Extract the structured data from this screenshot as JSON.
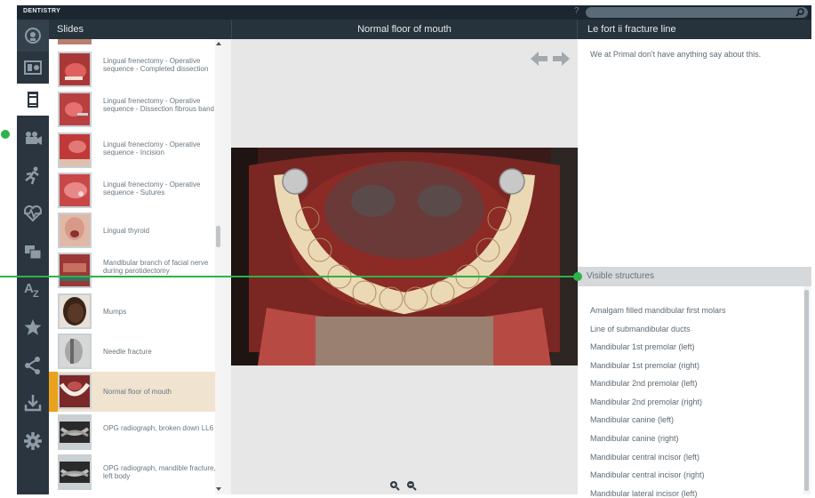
{
  "app": {
    "brand": "DENTISTRY"
  },
  "topbar": {
    "help_label": "?",
    "search_placeholder": ""
  },
  "toolbar": {
    "icons": [
      "3d-anatomy-icon",
      "slides-icon",
      "atlas-icon",
      "video-icon",
      "animation-icon",
      "physiology-icon",
      "folders-icon",
      "a-z-icon",
      "favorites-icon",
      "share-icon",
      "download-icon",
      "settings-icon"
    ]
  },
  "headers": {
    "slides": "Slides",
    "viewer": "Normal floor of mouth",
    "info": "Le fort ii fracture line"
  },
  "slides": [
    {
      "label": "Lingual frenectomy - Operative sequence - Completed dissection",
      "selected": false
    },
    {
      "label": "Lingual frenectomy - Operative sequence - Dissection fibrous band",
      "selected": false
    },
    {
      "label": "Lingual frenectomy - Operative sequence - Incision",
      "selected": false
    },
    {
      "label": "Lingual frenectomy - Operative sequence - Sutures",
      "selected": false
    },
    {
      "label": "Lingual thyroid",
      "selected": false
    },
    {
      "label": "Mandibular branch of facial nerve during parotidectomy",
      "selected": false
    },
    {
      "label": "Mumps",
      "selected": false
    },
    {
      "label": "Needle fracture",
      "selected": false
    },
    {
      "label": "Normal floor of mouth",
      "selected": true
    },
    {
      "label": "OPG radiograph, broken down LL6",
      "selected": false
    },
    {
      "label": "OPG radiograph, mandible fracture, left body",
      "selected": false
    }
  ],
  "info": {
    "note": "We at Primal don't have anything say about this."
  },
  "visible_structures": {
    "title": "Visible structures",
    "items": [
      "Amalgam filled mandibular first molars",
      "Line of submandibular ducts",
      "Mandibular 1st premolar (left)",
      "Mandibular 1st premolar (right)",
      "Mandibular 2nd premolar (left)",
      "Mandibular 2nd premolar (right)",
      "Mandibular canine (left)",
      "Mandibular canine (right)",
      "Mandibular central incisor (left)",
      "Mandibular central incisor (right)",
      "Mandibular lateral incisor (left)"
    ]
  },
  "colors": {
    "accent": "#e8a21c",
    "callout": "#2db34a",
    "dark": "#1f2a33"
  }
}
